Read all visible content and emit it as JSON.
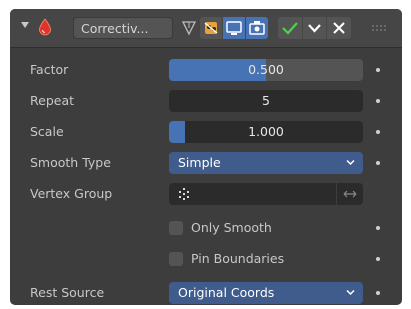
{
  "modifier": {
    "name": "Correctiv...",
    "icon": "water-drop-icon",
    "accent_color": "#4772b3"
  },
  "header_icons": [
    "edit-mode-icon",
    "on-cage-icon",
    "viewport-display-icon",
    "render-icon",
    "apply-check-icon",
    "move-down-chevron-icon",
    "close-icon",
    "drag-grip-icon"
  ],
  "properties": {
    "factor": {
      "label": "Factor",
      "value": "0.500",
      "fraction": 0.5
    },
    "repeat": {
      "label": "Repeat",
      "value": "5"
    },
    "scale": {
      "label": "Scale",
      "value": "1.000",
      "fraction": 0.08
    },
    "smooth_type": {
      "label": "Smooth Type",
      "value": "Simple"
    },
    "vertex_group": {
      "label": "Vertex Group",
      "value": ""
    },
    "only_smooth": {
      "label": "Only Smooth",
      "checked": false
    },
    "pin_boundaries": {
      "label": "Pin Boundaries",
      "checked": false
    },
    "rest_source": {
      "label": "Rest Source",
      "value": "Original Coords"
    }
  }
}
